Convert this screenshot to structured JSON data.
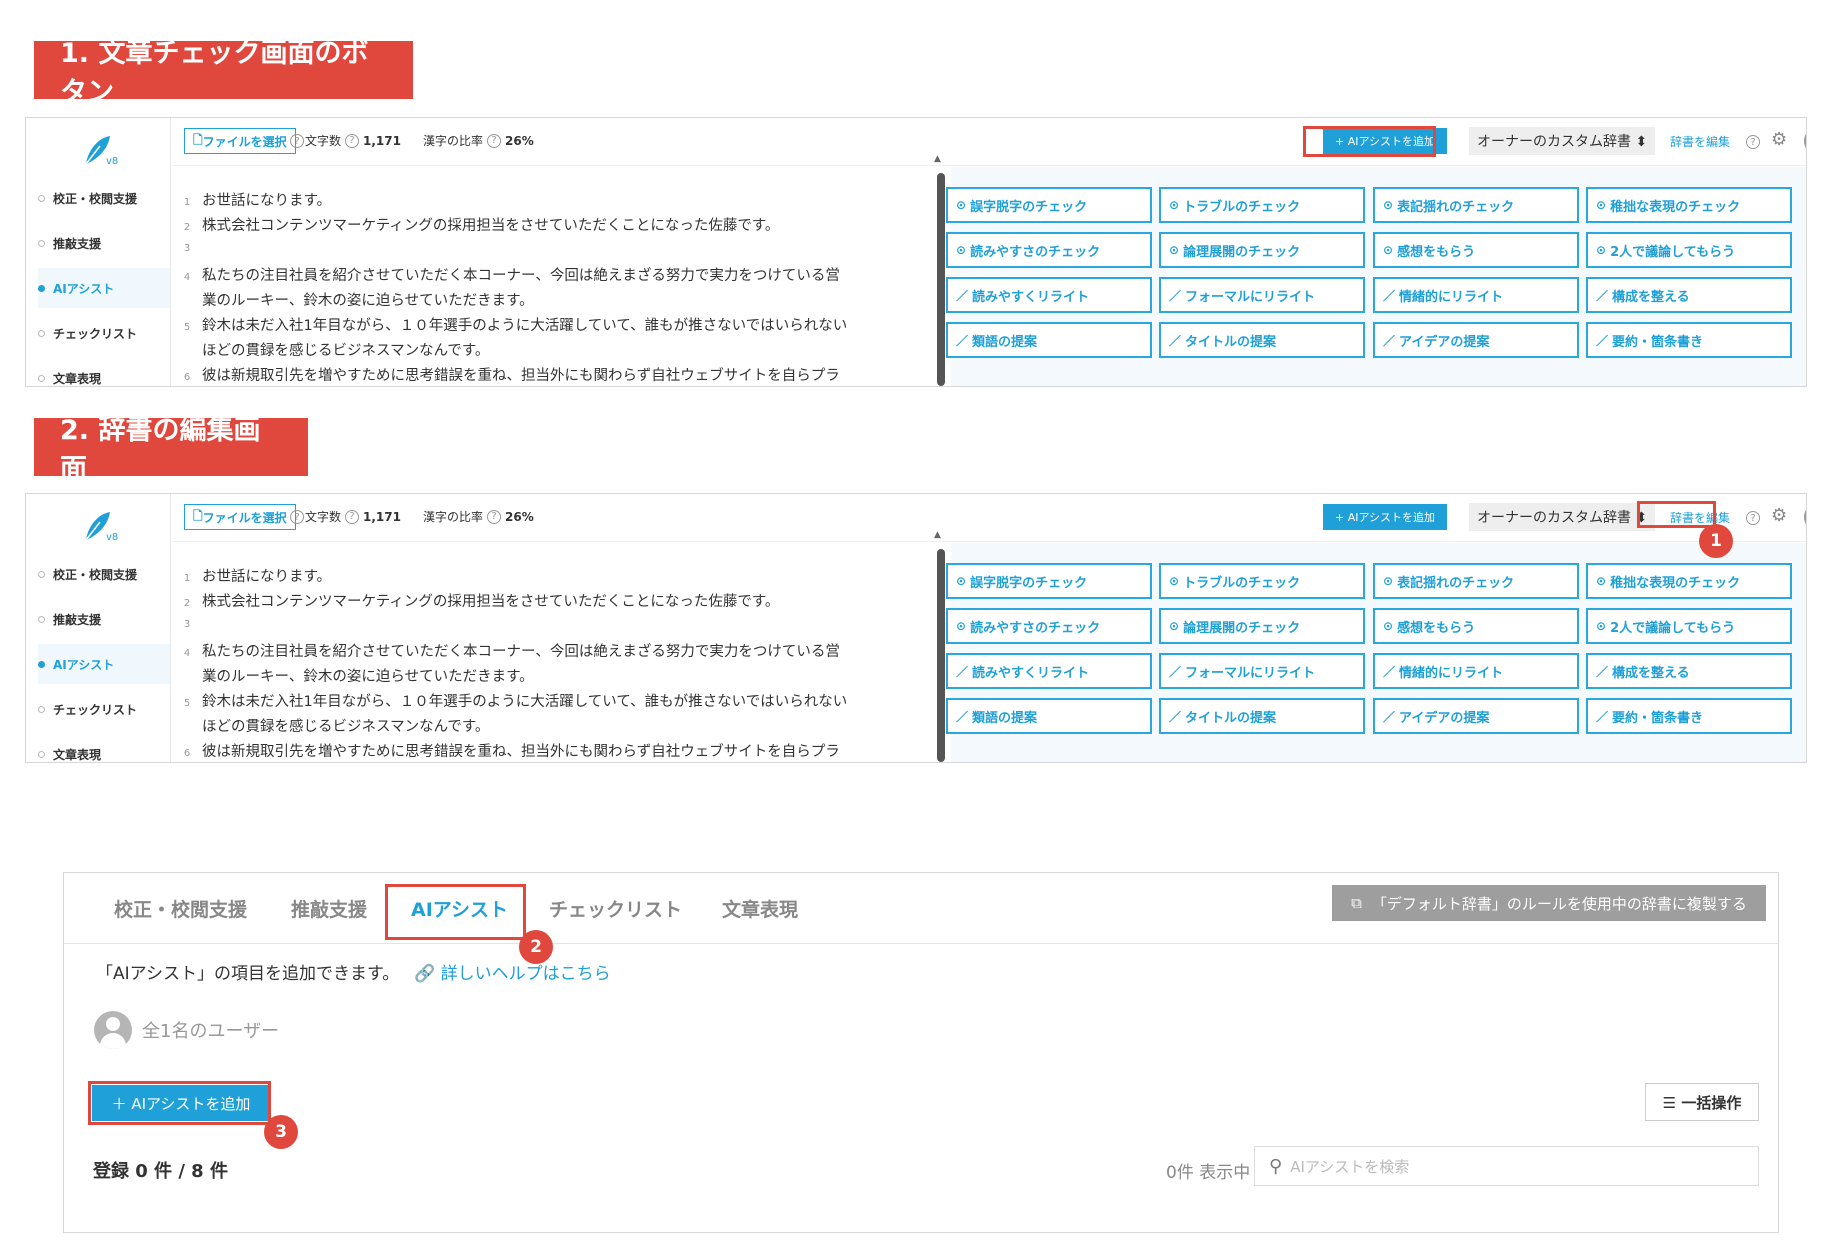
{
  "sections": {
    "s1_title": "1. 文章チェック画面のボタン",
    "s2_title": "2. 辞書の編集画面"
  },
  "app": {
    "logo_version": "v8",
    "sidebar": [
      "校正・校閲支援",
      "推敲支援",
      "AIアシスト",
      "チェックリスト",
      "文章表現"
    ],
    "file_button": "ファイルを選択",
    "char_count_label": "文字数",
    "char_count_value": "1,171",
    "kanji_ratio_label": "漢字の比率",
    "kanji_ratio_value": "26%",
    "ai_add_button": "+ AIアシストを追加",
    "dictionary_select": "オーナーのカスタム辞書 ⬍",
    "edit_dictionary": "辞書を編集",
    "lines": [
      {
        "n": "1",
        "text": "お世話になります。"
      },
      {
        "n": "2",
        "text": "株式会社コンテンツマーケティングの採用担当をさせていただくことになった佐藤です。"
      },
      {
        "n": "3",
        "text": ""
      },
      {
        "n": "4",
        "text": "私たちの注目社員を紹介させていただく本コーナー、今回は絶えまざる努力で実力をつけている営"
      },
      {
        "n": "",
        "text": "業のルーキー、鈴木の姿に迫らせていただきます。"
      },
      {
        "n": "5",
        "text": "鈴木は未だ入社1年目ながら、１０年選手のように大活躍していて、誰もが推さないではいられない"
      },
      {
        "n": "",
        "text": "ほどの貫録を感じるビジネスマンなんです。"
      },
      {
        "n": "6",
        "text": "彼は新規取引先を増やすために思考錯誤を重ね、担当外にも関わらず自社ウェブサイトを自らプラ"
      }
    ],
    "assist_buttons": [
      {
        "icon": "⊙",
        "label": "誤字脱字のチェック"
      },
      {
        "icon": "⊙",
        "label": "トラブルのチェック"
      },
      {
        "icon": "⊙",
        "label": "表記揺れのチェック"
      },
      {
        "icon": "⊙",
        "label": "稚拙な表現のチェック"
      },
      {
        "icon": "⊙",
        "label": "読みやすさのチェック"
      },
      {
        "icon": "⊙",
        "label": "論理展開のチェック"
      },
      {
        "icon": "⊙",
        "label": "感想をもらう"
      },
      {
        "icon": "⊙",
        "label": "2人で議論してもらう"
      },
      {
        "icon": "／",
        "label": "読みやすくリライト"
      },
      {
        "icon": "／",
        "label": "フォーマルにリライト"
      },
      {
        "icon": "／",
        "label": "情緒的にリライト"
      },
      {
        "icon": "／",
        "label": "構成を整える"
      },
      {
        "icon": "／",
        "label": "類語の提案"
      },
      {
        "icon": "／",
        "label": "タイトルの提案"
      },
      {
        "icon": "／",
        "label": "アイデアの提案"
      },
      {
        "icon": "／",
        "label": "要約・箇条書き"
      }
    ]
  },
  "dict": {
    "tabs": [
      "校正・校閲支援",
      "推敲支援",
      "AIアシスト",
      "チェックリスト",
      "文章表現"
    ],
    "copy_button": "「デフォルト辞書」のルールを使用中の辞書に複製する",
    "description": "「AIアシスト」の項目を追加できます。",
    "help_link": "詳しいヘルプはこちら",
    "users": "全1名のユーザー",
    "add_button": "＋ AIアシストを追加",
    "bulk_button": "☰ 一括操作",
    "registered": "登録 0 件 / 8 件",
    "showing": "0件 表示中",
    "search_placeholder": "AIアシストを検索"
  },
  "markers": [
    "1",
    "2",
    "3"
  ],
  "colors": {
    "accent": "#1fa0d8",
    "banner": "#e0483e",
    "highlight": "#e0483e"
  }
}
